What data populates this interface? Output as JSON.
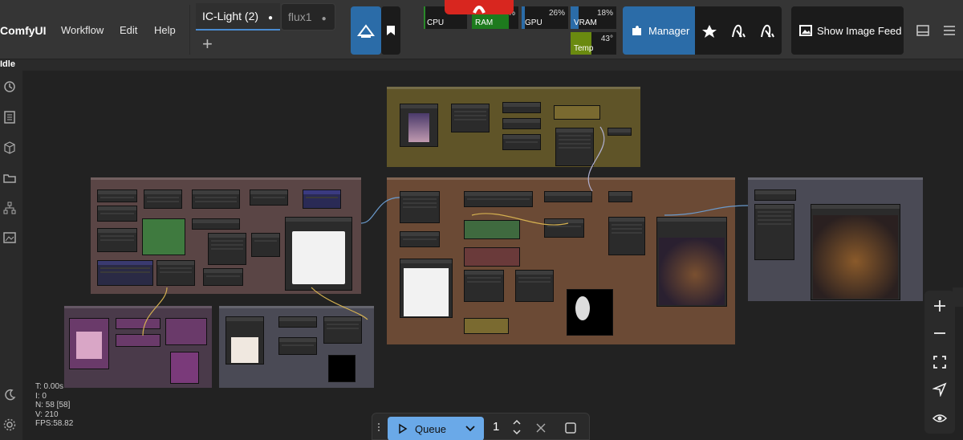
{
  "app": {
    "title": "ComfyUI"
  },
  "menu": {
    "workflow": "Workflow",
    "edit": "Edit",
    "help": "Help"
  },
  "tabs": [
    {
      "label": "IC-Light (2)",
      "dot": "●"
    },
    {
      "label": "flux1",
      "dot": "●"
    }
  ],
  "monitors": {
    "cpu": {
      "label": "CPU",
      "percent": ""
    },
    "ram": {
      "label": "RAM",
      "percent": "%"
    },
    "gpu": {
      "label": "GPU",
      "percent": "26%"
    },
    "vram": {
      "label": "VRAM",
      "percent": "18%"
    },
    "temp": {
      "label": "Temp",
      "value": "43°"
    }
  },
  "toolbar": {
    "manager_label": "Manager",
    "feed_label": "Show Image Feed"
  },
  "status": {
    "state": "Idle"
  },
  "stats": {
    "t": "T: 0.00s",
    "i": "I: 0",
    "n": "N: 58 [58]",
    "v": "V: 210",
    "fps": "FPS:58.82"
  },
  "queue": {
    "label": "Queue",
    "count": "1"
  },
  "colors": {
    "accent": "#2b6ca8",
    "queue": "#6aa9e8",
    "group_brown": "#6b4a35",
    "group_olive": "#5f5428",
    "group_gray": "#4a4a55",
    "group_purple": "#4a3a4a"
  }
}
